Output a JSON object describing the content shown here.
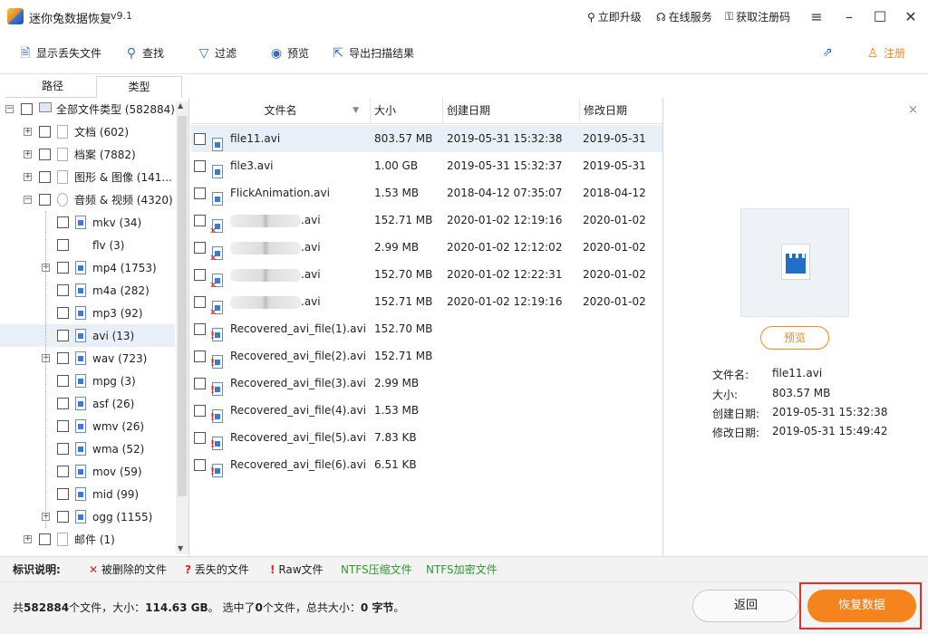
{
  "app": {
    "title": "迷你兔数据恢复",
    "version": "v9.1"
  },
  "title_links": {
    "upgrade": "立即升级",
    "online_service": "在线服务",
    "get_code": "获取注册码"
  },
  "toolbar": {
    "show_lost": "显示丢失文件",
    "find": "查找",
    "filter": "过滤",
    "preview": "预览",
    "export": "导出扫描结果",
    "register": "注册"
  },
  "tabs": {
    "path": "路径",
    "type": "类型"
  },
  "tree": {
    "items": [
      {
        "label": "全部文件类型 (582884)"
      },
      {
        "label": "文档 (602)"
      },
      {
        "label": "档案 (7882)"
      },
      {
        "label": "图形 & 图像 (141..."
      },
      {
        "label": "音频 & 视频 (4320)"
      },
      {
        "label": "mkv (34)"
      },
      {
        "label": "flv (3)"
      },
      {
        "label": "mp4 (1753)"
      },
      {
        "label": "m4a (282)"
      },
      {
        "label": "mp3 (92)"
      },
      {
        "label": "avi (13)"
      },
      {
        "label": "wav (723)"
      },
      {
        "label": "mpg (3)"
      },
      {
        "label": "asf (26)"
      },
      {
        "label": "wmv (26)"
      },
      {
        "label": "wma (52)"
      },
      {
        "label": "mov (59)"
      },
      {
        "label": "mid (99)"
      },
      {
        "label": "ogg (1155)"
      },
      {
        "label": "邮件 (1)"
      }
    ]
  },
  "list": {
    "columns": {
      "name": "文件名",
      "size": "大小",
      "created": "创建日期",
      "modified": "修改日期"
    },
    "rows": [
      {
        "name": "file11.avi",
        "size": "803.57 MB",
        "created": "2019-05-31 15:32:38",
        "modified": "2019-05-31"
      },
      {
        "name": "file3.avi",
        "size": "1.00 GB",
        "created": "2019-05-31 15:32:37",
        "modified": "2019-05-31"
      },
      {
        "name": "FlickAnimation.avi",
        "size": "1.53 MB",
        "created": "2018-04-12 07:35:07",
        "modified": "2018-04-12"
      },
      {
        "name": ".avi",
        "size": "152.71 MB",
        "created": "2020-01-02 12:19:16",
        "modified": "2020-01-02"
      },
      {
        "name": ".avi",
        "size": "2.99 MB",
        "created": "2020-01-02 12:12:02",
        "modified": "2020-01-02"
      },
      {
        "name": ".avi",
        "size": "152.70 MB",
        "created": "2020-01-02 12:22:31",
        "modified": "2020-01-02"
      },
      {
        "name": ".avi",
        "size": "152.71 MB",
        "created": "2020-01-02 12:19:16",
        "modified": "2020-01-02"
      },
      {
        "name": "Recovered_avi_file(1).avi",
        "size": "152.70 MB",
        "created": "",
        "modified": ""
      },
      {
        "name": "Recovered_avi_file(2).avi",
        "size": "152.71 MB",
        "created": "",
        "modified": ""
      },
      {
        "name": "Recovered_avi_file(3).avi",
        "size": "2.99 MB",
        "created": "",
        "modified": ""
      },
      {
        "name": "Recovered_avi_file(4).avi",
        "size": "1.53 MB",
        "created": "",
        "modified": ""
      },
      {
        "name": "Recovered_avi_file(5).avi",
        "size": "7.83 KB",
        "created": "",
        "modified": ""
      },
      {
        "name": "Recovered_avi_file(6).avi",
        "size": "6.51 KB",
        "created": "",
        "modified": ""
      }
    ]
  },
  "preview": {
    "button": "预览",
    "labels": {
      "name": "文件名:",
      "size": "大小:",
      "created": "创建日期:",
      "modified": "修改日期:"
    },
    "values": {
      "name": "file11.avi",
      "size": "803.57 MB",
      "created": "2019-05-31 15:32:38",
      "modified": "2019-05-31 15:49:42"
    }
  },
  "legend": {
    "title": "标识说明:",
    "deleted": "被删除的文件",
    "lost": "丢失的文件",
    "raw": "Raw文件",
    "ntfs_compressed": "NTFS压缩文件",
    "ntfs_encrypted": "NTFS加密文件",
    "colors": {
      "deleted": "#e02020",
      "ntfs": "#2e9a2e"
    }
  },
  "status": {
    "prefix": "共",
    "total_files": "582884",
    "mid1": "个文件，大小：",
    "total_size": "114.63 GB",
    "mid2": "。 选中了",
    "selected_count": "0",
    "mid3": "个文件，总共大小：",
    "selected_size": "0 字节",
    "suffix": "。"
  },
  "buttons": {
    "back": "返回",
    "recover": "恢复数据"
  },
  "colors": {
    "accent": "#f5841f",
    "highlight": "#e0302a"
  }
}
